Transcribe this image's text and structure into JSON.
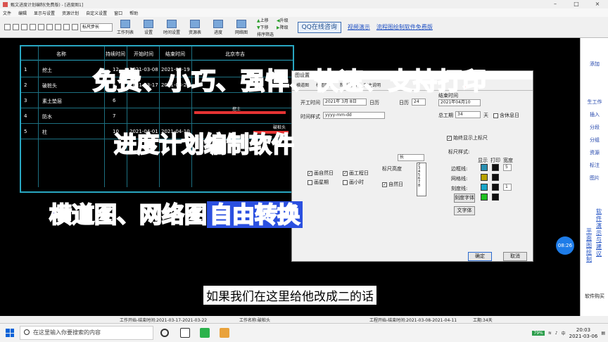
{
  "window": {
    "title": "甄文进度计划编制(免费版) - [进度图1]"
  },
  "menu": [
    "文件",
    "编辑",
    "显示与设置",
    "资源计划",
    "自定义设置",
    "窗口",
    "帮助"
  ],
  "toolbar": {
    "step_select": "标尺步长",
    "big_buttons": [
      "工作列表",
      "设置",
      "时间设置",
      "资源表",
      "进度",
      "网络图"
    ],
    "arrow_buttons": [
      "上移",
      "升级",
      "下移",
      "降级",
      "排序筛选"
    ],
    "qq_button": "QQ在线咨询",
    "links": [
      "视频演示",
      "流程图绘制软件免费版"
    ]
  },
  "table": {
    "headers": [
      "名称",
      "持续时间",
      "开始时间",
      "结束时间",
      "北京市吉"
    ],
    "rows": [
      {
        "id": "1",
        "name": "挖土",
        "dur": "12",
        "start": "2021-03-08",
        "end": "2021-03-19"
      },
      {
        "id": "2",
        "name": "破桩头",
        "dur": "5",
        "start": "2021-03-17",
        "end": "2021-03-22"
      },
      {
        "id": "3",
        "name": "素土垫层",
        "dur": "6",
        "start": "",
        "end": ""
      },
      {
        "id": "4",
        "name": "防水",
        "dur": "7",
        "start": "",
        "end": ""
      },
      {
        "id": "5",
        "name": "柱",
        "dur": "10",
        "start": "2021-04-01",
        "end": "2021-04-10"
      }
    ],
    "bar_labels": [
      "挖土",
      "破桩头"
    ]
  },
  "overlay": {
    "headline": "免费、小巧、强悍、快速、支持打印",
    "subhead": "进度计划编制软件",
    "convert_a": "横道图、网络图",
    "convert_b": "自由转换",
    "caption": "如果我们在这里给他改成二的话"
  },
  "dialog": {
    "title": "图设置",
    "tabs": [
      "横道图",
      "横道图属",
      "制表视图",
      "图主说明"
    ],
    "start_label": "开工时间",
    "start_value": "2021年 3月 8日",
    "daily_label": "日历",
    "end_label": "结束时间",
    "end_value": "2021年04月10",
    "hours_label": "日历",
    "hours_value": "24",
    "total_label": "总工期",
    "total_value": "34",
    "total_unit": "天",
    "holiday_label": "含休息日",
    "time_style_label": "时间样式",
    "time_style_value": "yyyy-mm-dd",
    "ruler_section": "标尺样式:",
    "show_ruler": "始终显示上标尺",
    "ruler_height": "标尺高度",
    "ruler_height_value": "长",
    "cols": [
      "显示",
      "打印",
      "宽度"
    ],
    "edge_line": "边框线:",
    "edge_width": "5",
    "grid_line": "网格线:",
    "scale_line": "刻度线:",
    "scale_width": "1",
    "checkboxes": [
      "画自然日",
      "画工程日",
      "画星期",
      "画小时"
    ],
    "auto_label": "自然日",
    "font_btn": "刻度字体",
    "font_btn2": "文字体",
    "ok": "确定",
    "cancel": "取消",
    "dropdown_items": [
      "2",
      "3",
      "4",
      "5",
      "6",
      "7",
      "8"
    ],
    "colors": {
      "edge_show": "#2a8fb0",
      "edge_print": "#111111",
      "grid_show": "#b8a200",
      "grid_print": "#111111",
      "scale_show": "#19a5c7",
      "scale_print": "#111111",
      "extra_show": "#20c020",
      "extra_print": "#111111"
    }
  },
  "right_panel": {
    "items": [
      "添加",
      "生工作",
      "插入",
      "分段",
      "分组",
      "资源",
      "标注",
      "图片"
    ],
    "vlink_a": "平面图绘制",
    "vlink_b": "软件演示与建议",
    "buy": "软件购买"
  },
  "time_badge": "08:26",
  "status": {
    "left": "工作开始-结束时间:2021-03-17-2021-03-22",
    "mid": "工作名称:破桩头",
    "right": "工程开始-结束时间:2021-03-08-2021-04-11",
    "span": "工期:34天"
  },
  "taskbar": {
    "search_placeholder": "在这里输入你要搜索的内容",
    "battery": "79%",
    "ime": "中",
    "time": "20:03",
    "date": "2021-03-06"
  }
}
